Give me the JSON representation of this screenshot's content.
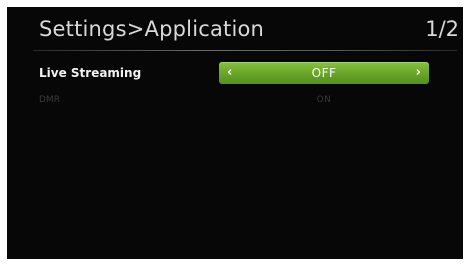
{
  "header": {
    "breadcrumb": "Settings>Application",
    "page_indicator": "1/2"
  },
  "settings": [
    {
      "label": "Live Streaming",
      "value": "OFF",
      "left_icon": "chevron-left-icon",
      "right_icon": "chevron-right-icon",
      "left_glyph": "‹",
      "right_glyph": "›"
    },
    {
      "label": "DMR",
      "value": "ON"
    }
  ],
  "colors": {
    "background": "#070707",
    "selector_green": "#6aa62a",
    "text_active": "#f2f2f2",
    "text_dim": "#3a3a3a"
  }
}
